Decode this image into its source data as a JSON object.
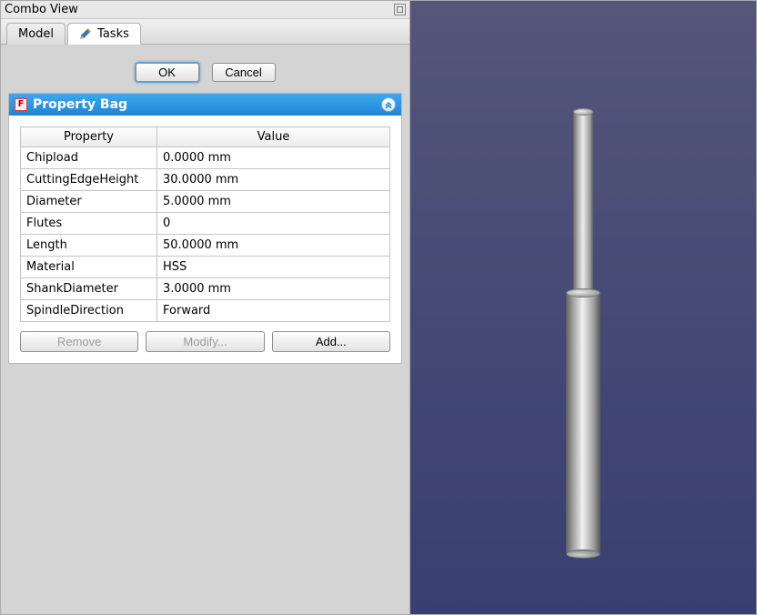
{
  "window": {
    "title": "Combo View"
  },
  "tabs": {
    "model": "Model",
    "tasks": "Tasks",
    "active": "tasks"
  },
  "dialog": {
    "ok": "OK",
    "cancel": "Cancel"
  },
  "panel": {
    "title": "Property Bag"
  },
  "table": {
    "headers": {
      "property": "Property",
      "value": "Value"
    },
    "rows": [
      {
        "name": "Chipload",
        "value": "0.0000 mm"
      },
      {
        "name": "CuttingEdgeHeight",
        "value": "30.0000 mm"
      },
      {
        "name": "Diameter",
        "value": "5.0000 mm"
      },
      {
        "name": "Flutes",
        "value": "0"
      },
      {
        "name": "Length",
        "value": "50.0000 mm"
      },
      {
        "name": "Material",
        "value": "HSS"
      },
      {
        "name": "ShankDiameter",
        "value": "3.0000 mm"
      },
      {
        "name": "SpindleDirection",
        "value": "Forward"
      }
    ]
  },
  "buttons": {
    "remove": "Remove",
    "modify": "Modify...",
    "add": "Add..."
  }
}
